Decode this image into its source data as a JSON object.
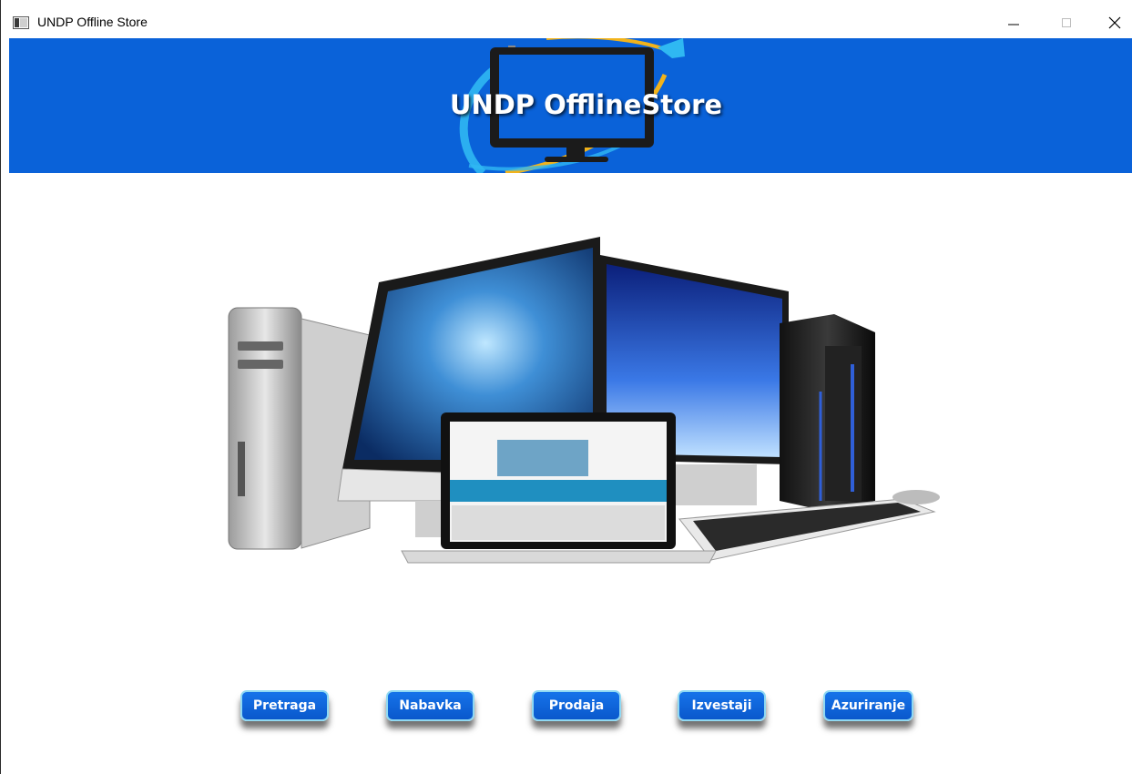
{
  "window": {
    "title": "UNDP Offline Store",
    "controls": {
      "minimize_icon": "minimize-icon",
      "maximize_icon": "maximize-icon",
      "close_icon": "close-icon"
    }
  },
  "banner": {
    "title": "UNDP OfflineStore",
    "background_color": "#0a62d9",
    "logo_icon": "monitor-gear-wrench-logo"
  },
  "hero": {
    "image_description_icon": "computers-group-illustration"
  },
  "nav_buttons": [
    {
      "label": "Pretraga"
    },
    {
      "label": "Nabavka"
    },
    {
      "label": "Prodaja"
    },
    {
      "label": "Izvestaji"
    },
    {
      "label": "Azuriranje"
    }
  ],
  "colors": {
    "button_fill": "#0a62d9",
    "button_border": "#8fd8f2",
    "accent_yellow": "#f2b31b"
  }
}
